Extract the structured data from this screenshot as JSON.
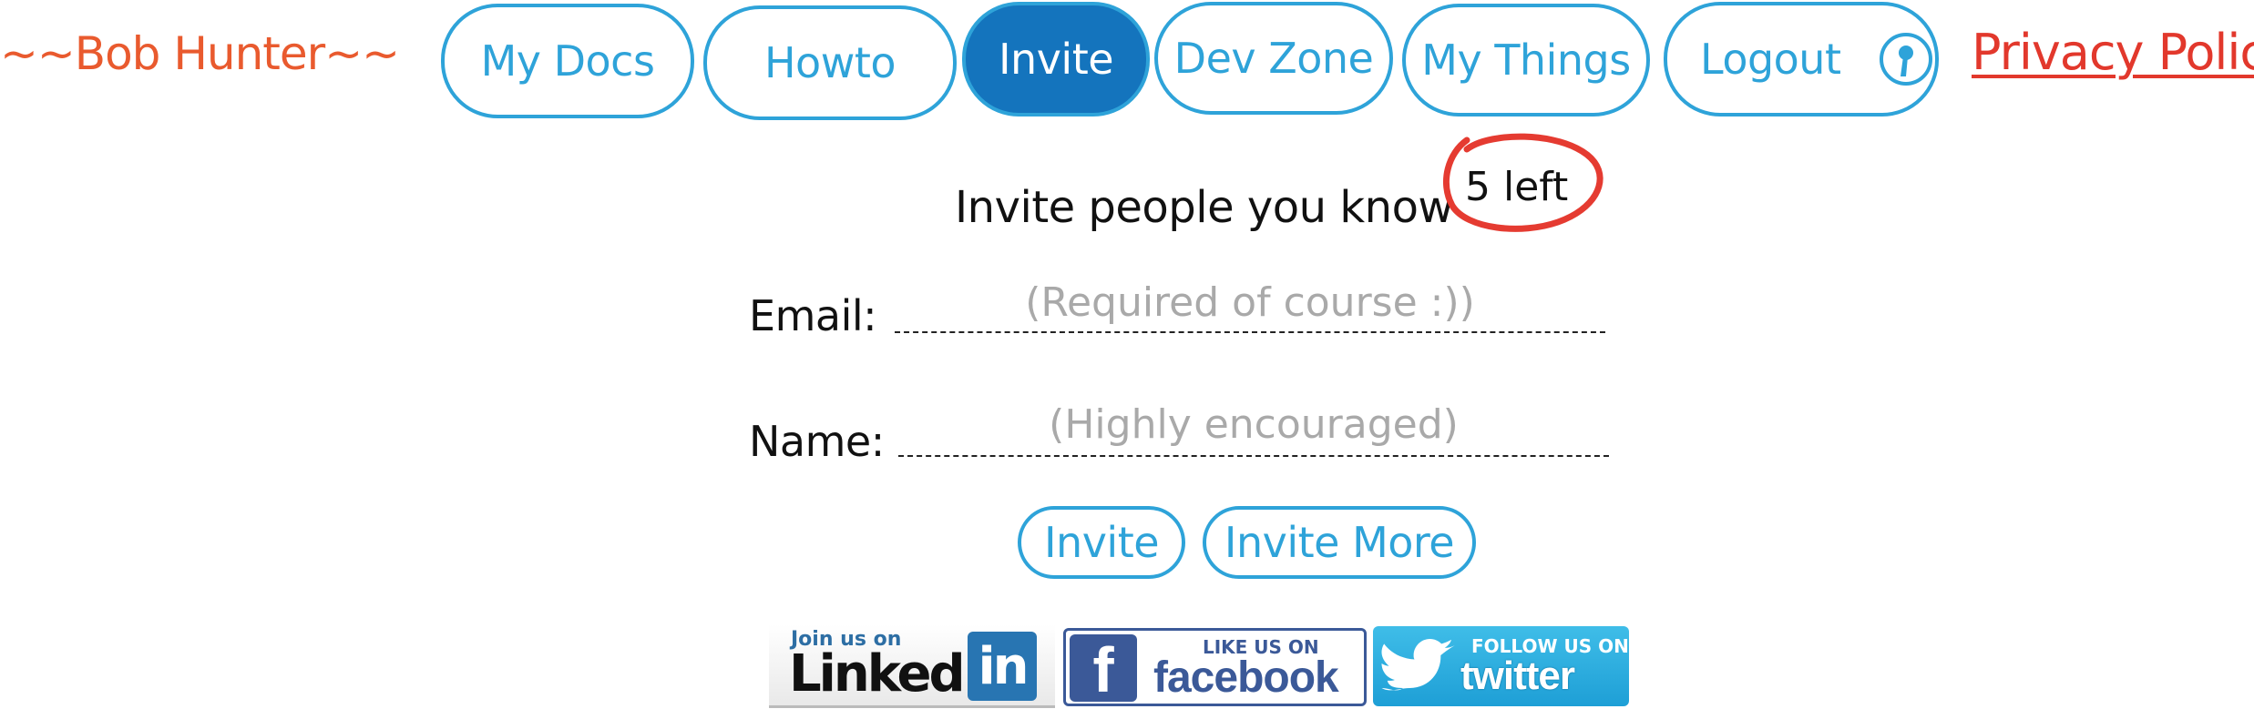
{
  "header": {
    "user_name": "~~Bob Hunter~~",
    "privacy_link": "Privacy Policy"
  },
  "nav": {
    "active_tab": "Invite",
    "items": [
      {
        "label": "My Docs"
      },
      {
        "label": "Howto"
      },
      {
        "label": "Invite"
      },
      {
        "label": "Dev Zone"
      },
      {
        "label": "My Things"
      },
      {
        "label": "Logout",
        "icon": "power-icon"
      }
    ]
  },
  "invite": {
    "heading": "Invite people you know",
    "remaining": "5 left",
    "email_label": "Email:",
    "email_placeholder": "(Required of course :))",
    "email_value": "",
    "name_label": "Name:",
    "name_placeholder": "(Highly encouraged)",
    "name_value": "",
    "invite_button": "Invite",
    "invite_more_button": "Invite More"
  },
  "social": {
    "linkedin": {
      "small": "Join us on",
      "big": "Linked",
      "box": "in"
    },
    "facebook": {
      "small": "LIKE US ON",
      "big": "facebook",
      "letter": "f"
    },
    "twitter": {
      "small": "FOLLOW US ON",
      "big": "twitter",
      "icon": "bird-icon"
    }
  },
  "colors": {
    "accent": "#2ea3d9",
    "active": "#1474bd",
    "user_name": "#e95a2e",
    "privacy": "#e2382c",
    "badge_circle": "#e53b31"
  }
}
